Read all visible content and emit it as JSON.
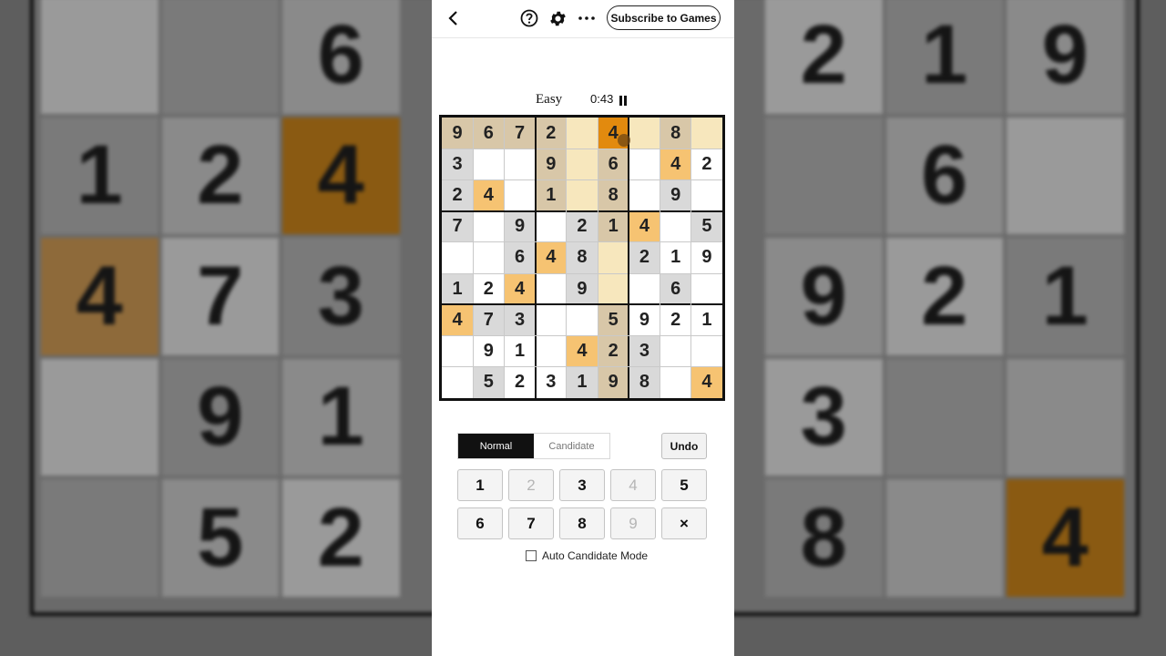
{
  "header": {
    "back_icon": "chevron-left-icon",
    "help_icon": "help-circle-icon",
    "settings_icon": "gear-icon",
    "more_icon": "more-dots-icon",
    "subscribe_label": "Subscribe to Games"
  },
  "status": {
    "difficulty": "Easy",
    "timer": "0:43",
    "pause_icon": "pause-icon"
  },
  "colors": {
    "selected": "#e28a0e",
    "same_number": "#f6c372",
    "highlight_region": "#f7e7bd",
    "given": "#d9d9d9",
    "given_highlight": "#d8c7a8",
    "background_blur": "#5e5e5e"
  },
  "board": {
    "rows": [
      [
        "9",
        "6",
        "7",
        "2",
        "",
        "4",
        "",
        "8",
        ""
      ],
      [
        "3",
        "",
        "",
        "9",
        "",
        "6",
        "",
        "4",
        "2"
      ],
      [
        "2",
        "4",
        "",
        "1",
        "",
        "8",
        "",
        "9",
        ""
      ],
      [
        "7",
        "",
        "9",
        "",
        "2",
        "1",
        "4",
        "",
        "5"
      ],
      [
        "",
        "",
        "6",
        "4",
        "8",
        "",
        "2",
        "1",
        "9"
      ],
      [
        "1",
        "2",
        "4",
        "",
        "9",
        "",
        "",
        "6",
        ""
      ],
      [
        "4",
        "7",
        "3",
        "",
        "",
        "5",
        "9",
        "2",
        "1"
      ],
      [
        "",
        "9",
        "1",
        "",
        "4",
        "2",
        "3",
        "",
        ""
      ],
      [
        "",
        "5",
        "2",
        "3",
        "1",
        "9",
        "8",
        "",
        "4"
      ]
    ],
    "styles": [
      [
        "gh",
        "gh",
        "gh",
        "gh",
        "h",
        "sel",
        "h",
        "gh",
        "h"
      ],
      [
        "g",
        "w",
        "w",
        "gh",
        "h",
        "gh",
        "w",
        "same",
        "w"
      ],
      [
        "g",
        "same",
        "w",
        "gh",
        "h",
        "gh",
        "w",
        "g",
        "w"
      ],
      [
        "g",
        "w",
        "g",
        "w",
        "g",
        "gh",
        "same",
        "w",
        "g"
      ],
      [
        "w",
        "w",
        "g",
        "same",
        "g",
        "h",
        "g",
        "w",
        "w"
      ],
      [
        "g",
        "w",
        "same",
        "w",
        "g",
        "h",
        "w",
        "g",
        "w"
      ],
      [
        "same",
        "g",
        "g",
        "w",
        "w",
        "gh",
        "w",
        "w",
        "w"
      ],
      [
        "w",
        "w",
        "w",
        "w",
        "same",
        "gh",
        "g",
        "w",
        "w"
      ],
      [
        "w",
        "g",
        "w",
        "w",
        "g",
        "gh",
        "g",
        "w",
        "same"
      ]
    ]
  },
  "controls": {
    "mode_normal": "Normal",
    "mode_candidate": "Candidate",
    "undo_label": "Undo",
    "keys": [
      {
        "label": "1",
        "disabled": false
      },
      {
        "label": "2",
        "disabled": true
      },
      {
        "label": "3",
        "disabled": false
      },
      {
        "label": "4",
        "disabled": true
      },
      {
        "label": "5",
        "disabled": false
      },
      {
        "label": "6",
        "disabled": false
      },
      {
        "label": "7",
        "disabled": false
      },
      {
        "label": "8",
        "disabled": false
      },
      {
        "label": "9",
        "disabled": true
      },
      {
        "label": "×",
        "disabled": false
      }
    ],
    "auto_candidate_label": "Auto Candidate Mode",
    "auto_candidate_checked": false
  },
  "background_cells": [
    {
      "text": "6",
      "col": 2,
      "row": 0
    },
    {
      "text": "2",
      "col": 6,
      "row": 0
    },
    {
      "text": "1",
      "col": 7,
      "row": 0
    },
    {
      "text": "9",
      "col": 8,
      "row": 0
    },
    {
      "text": "1",
      "col": 0,
      "row": 1
    },
    {
      "text": "2",
      "col": 1,
      "row": 1
    },
    {
      "text": "4",
      "col": 2,
      "row": 1
    },
    {
      "text": "6",
      "col": 7,
      "row": 1
    },
    {
      "text": "4",
      "col": 0,
      "row": 2
    },
    {
      "text": "7",
      "col": 1,
      "row": 2
    },
    {
      "text": "3",
      "col": 2,
      "row": 2
    },
    {
      "text": "9",
      "col": 6,
      "row": 2
    },
    {
      "text": "2",
      "col": 7,
      "row": 2
    },
    {
      "text": "1",
      "col": 8,
      "row": 2
    },
    {
      "text": "9",
      "col": 1,
      "row": 3
    },
    {
      "text": "1",
      "col": 2,
      "row": 3
    },
    {
      "text": "3",
      "col": 6,
      "row": 3
    },
    {
      "text": "5",
      "col": 1,
      "row": 4
    },
    {
      "text": "2",
      "col": 2,
      "row": 4
    },
    {
      "text": "8",
      "col": 6,
      "row": 4
    },
    {
      "text": "4",
      "col": 8,
      "row": 4
    }
  ]
}
